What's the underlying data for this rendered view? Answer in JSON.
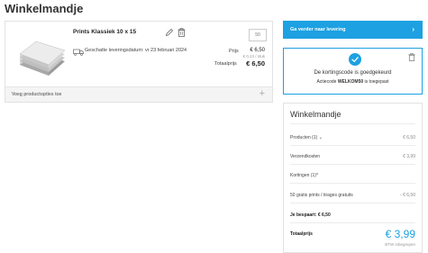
{
  "page": {
    "title": "Winkelmandje"
  },
  "product": {
    "name": "Prints Klassiek 10 x 15",
    "quantity": "50",
    "delivery": "Geschatte leveringsdatum: vr 23 februari 2024",
    "price_label": "Prijs",
    "price": "€ 6,50",
    "price_per_unit": "€ 0,13 / stuk",
    "total_label": "Totaalprijs",
    "total": "€ 6,50",
    "options_label": "Voeg productopties toe",
    "options_icon": "plus-icon"
  },
  "checkout": {
    "label": "Ga verder naar levering",
    "icon": "chevron-right-icon"
  },
  "coupon": {
    "message": "De kortingscode is goedgekeurd",
    "code_prefix": "Actiecode ",
    "code": "WELKOM50",
    "code_suffix": " is toegepast",
    "icon": "check-icon",
    "accent": "#1da1e2"
  },
  "cart": {
    "title": "Winkelmandje",
    "products_label": "Producten (1)",
    "products_value": "€ 6,50",
    "shipping_label": "Verzendkosten",
    "shipping_value": "€ 3,99",
    "discounts_label": "Kortingen (1)",
    "discount_item_label": "50 gratis prints / tirages gratuits",
    "discount_item_value": "- € 6,50",
    "savings_text": "Je bespaart: € 6,50",
    "total_label": "Totaalprijs",
    "total_value": "€ 3,99",
    "vat_note": "BTW inbegrepen"
  }
}
